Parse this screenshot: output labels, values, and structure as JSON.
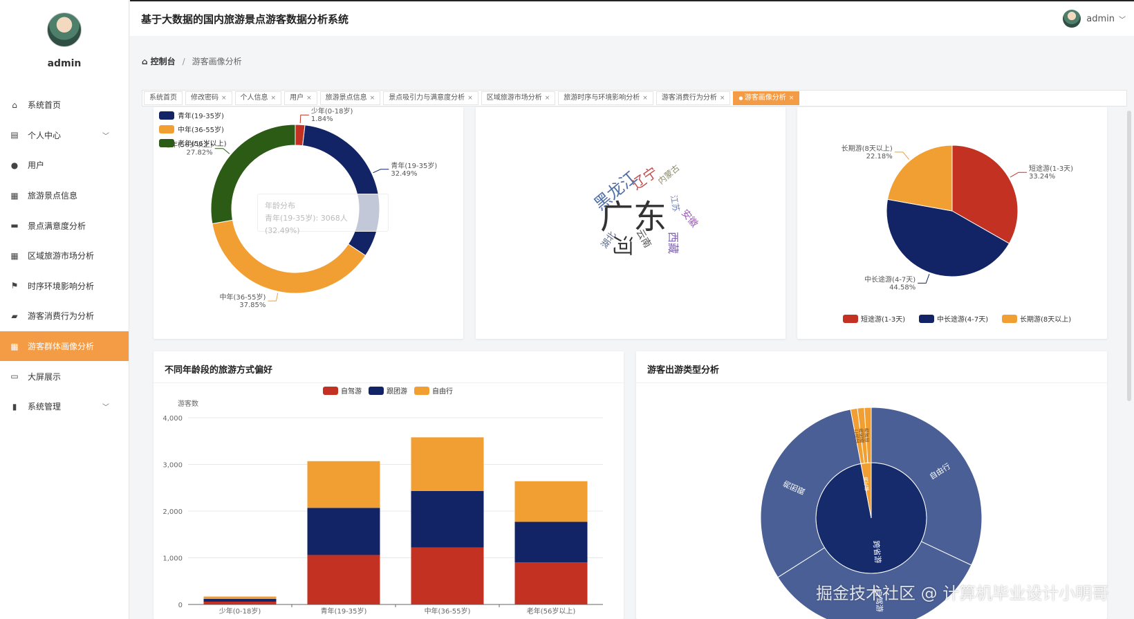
{
  "app": {
    "title": "基于大数据的国内旅游景点游客数据分析系统",
    "user": "admin"
  },
  "sidebar": {
    "profile_name": "admin",
    "items": [
      {
        "label": "系统首页",
        "icon": "home-icon",
        "glyph": "⌂"
      },
      {
        "label": "个人中心",
        "icon": "card-icon",
        "glyph": "▤",
        "expandable": true
      },
      {
        "label": "用户",
        "icon": "bulb-icon",
        "glyph": "●"
      },
      {
        "label": "旅游景点信息",
        "icon": "clipboard-icon",
        "glyph": "▦"
      },
      {
        "label": "景点满意度分析",
        "icon": "briefcase-icon",
        "glyph": "▬"
      },
      {
        "label": "区域旅游市场分析",
        "icon": "clipboard-icon",
        "glyph": "▦"
      },
      {
        "label": "时序环境影响分析",
        "icon": "flag-icon",
        "glyph": "⚑"
      },
      {
        "label": "游客消费行为分析",
        "icon": "ticket-icon",
        "glyph": "▰"
      },
      {
        "label": "游客群体画像分析",
        "icon": "grid-icon",
        "glyph": "▦",
        "active": true
      },
      {
        "label": "大屏展示",
        "icon": "monitor-icon",
        "glyph": "▭"
      },
      {
        "label": "系统管理",
        "icon": "bar-chart-icon",
        "glyph": "▮",
        "expandable": true
      }
    ]
  },
  "breadcrumb": {
    "home": "控制台",
    "current": "游客画像分析"
  },
  "tabs": [
    {
      "label": "系统首页",
      "closable": false
    },
    {
      "label": "修改密码",
      "closable": true
    },
    {
      "label": "个人信息",
      "closable": true
    },
    {
      "label": "用户",
      "closable": true
    },
    {
      "label": "旅游景点信息",
      "closable": true
    },
    {
      "label": "景点吸引力与满意度分析",
      "closable": true
    },
    {
      "label": "区域旅游市场分析",
      "closable": true
    },
    {
      "label": "旅游时序与环境影响分析",
      "closable": true
    },
    {
      "label": "游客消费行为分析",
      "closable": true
    },
    {
      "label": "游客画像分析",
      "closable": true,
      "active": true
    }
  ],
  "age_tooltip": {
    "title": "年龄分布",
    "line": "青年(19-35岁): 3068人 (32.49%)"
  },
  "chart_data": [
    {
      "type": "pie",
      "variant": "donut",
      "legend_position": "top-left",
      "legend": [
        "青年(19-35岁)",
        "中年(36-55岁)",
        "老年(56岁以上)"
      ],
      "slices": [
        {
          "name": "少年(0-18岁)",
          "value": 1.84,
          "color": "#c23121"
        },
        {
          "name": "青年(19-35岁)",
          "value": 32.49,
          "color": "#132466"
        },
        {
          "name": "中年(36-55岁)",
          "value": 37.85,
          "color": "#f19f33"
        },
        {
          "name": "老年(56岁以上)",
          "value": 27.82,
          "color": "#2b5b14"
        }
      ]
    },
    {
      "type": "wordcloud",
      "words": [
        {
          "text": "广东",
          "color": "#333333"
        },
        {
          "text": "黑龙江",
          "color": "#4e6fa8"
        },
        {
          "text": "辽宁",
          "color": "#c0504d"
        },
        {
          "text": "内蒙古",
          "color": "#8a8a6a"
        },
        {
          "text": "江苏",
          "color": "#6f7fbf"
        },
        {
          "text": "安徽",
          "color": "#9b59b6"
        },
        {
          "text": "云南",
          "color": "#555555"
        },
        {
          "text": "湖北",
          "color": "#5a6a8a"
        },
        {
          "text": "西藏",
          "color": "#7d5fb0"
        },
        {
          "text": "河",
          "color": "#333333"
        }
      ]
    },
    {
      "type": "pie",
      "legend_position": "bottom",
      "legend": [
        "短途游(1-3天)",
        "中长途游(4-7天)",
        "长期游(8天以上)"
      ],
      "slices": [
        {
          "name": "短途游(1-3天)",
          "value": 33.24,
          "color": "#c23121"
        },
        {
          "name": "中长途游(4-7天)",
          "value": 44.58,
          "color": "#132466"
        },
        {
          "name": "长期游(8天以上)",
          "value": 22.18,
          "color": "#f19f33"
        }
      ]
    },
    {
      "type": "bar",
      "stacked": true,
      "title": "不同年龄段的旅游方式偏好",
      "ylabel": "游客数",
      "ylim": [
        0,
        4000
      ],
      "yticks": [
        "0",
        "1,000",
        "2,000",
        "3,000",
        "4,000"
      ],
      "grid": true,
      "legend_position": "top",
      "categories": [
        "少年(0-18岁)",
        "青年(19-35岁)",
        "中年(36-55岁)",
        "老年(56岁以上)"
      ],
      "series": [
        {
          "name": "自驾游",
          "color": "#c23121",
          "values": [
            60,
            1060,
            1220,
            900
          ]
        },
        {
          "name": "跟团游",
          "color": "#132466",
          "values": [
            60,
            1010,
            1210,
            870
          ]
        },
        {
          "name": "自由行",
          "color": "#f19f33",
          "values": [
            50,
            1000,
            1150,
            870
          ]
        }
      ]
    },
    {
      "type": "sunburst",
      "title": "游客出游类型分析",
      "inner": [
        {
          "name": "跨省游",
          "value": 97,
          "color": "#152b6c"
        },
        {
          "name": "省内游",
          "value": 3,
          "color": "#f19f33"
        }
      ],
      "outer": [
        {
          "name": "自由行",
          "value": 32,
          "color": "#4a5f95"
        },
        {
          "name": "自驾游",
          "value": 34,
          "color": "#4a5f95"
        },
        {
          "name": "跟团游",
          "value": 31,
          "color": "#4a5f95"
        },
        {
          "name": "自由行",
          "value": 1,
          "color": "#f19f33"
        },
        {
          "name": "跟团游",
          "value": 1,
          "color": "#f19f33"
        },
        {
          "name": "自驾游",
          "value": 1,
          "color": "#f19f33"
        }
      ]
    }
  ],
  "watermark": "掘金技术社区 @ 计算机毕业设计小明哥",
  "colors": {
    "accent": "#f39c45"
  }
}
